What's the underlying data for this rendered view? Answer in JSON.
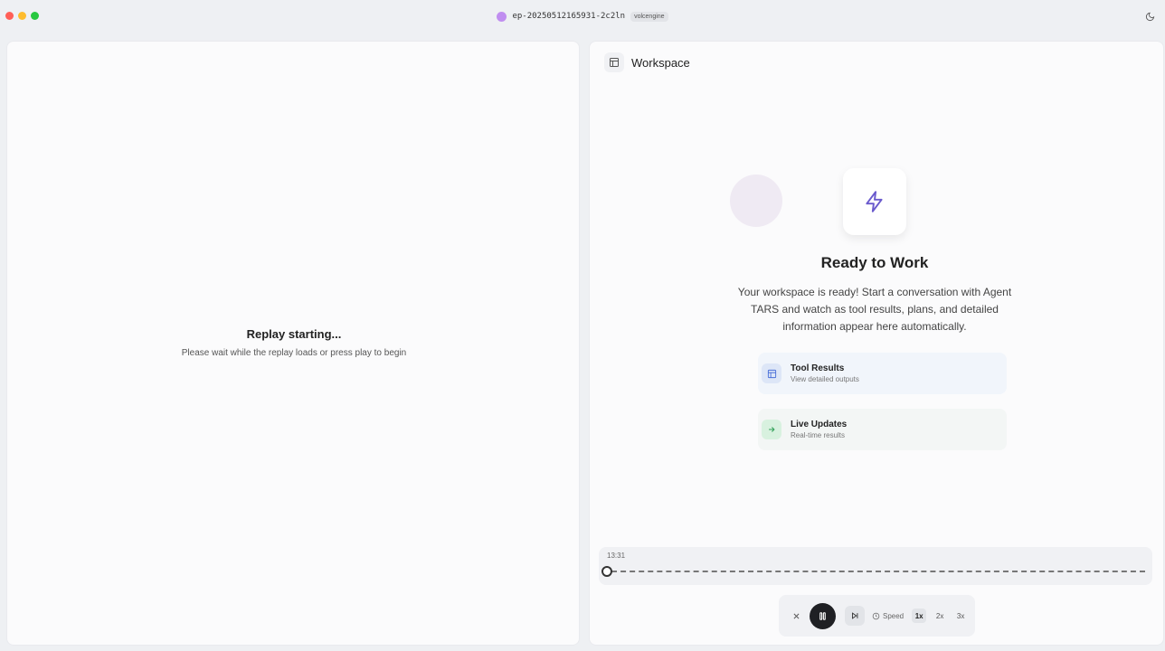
{
  "titlebar": {
    "session_id": "ep-20250512165931-2c2ln",
    "model_badge": "volcengine"
  },
  "left": {
    "replay_title": "Replay starting...",
    "replay_sub": "Please wait while the replay loads or press play to begin"
  },
  "workspace": {
    "title": "Workspace",
    "ready_title": "Ready to Work",
    "ready_desc": "Your workspace is ready! Start a conversation with Agent TARS and watch as tool results, plans, and detailed information appear here automatically.",
    "features": [
      {
        "title": "Tool Results",
        "subtitle": "View detailed outputs",
        "icon": "panel-icon"
      },
      {
        "title": "Live Updates",
        "subtitle": "Real-time results",
        "icon": "arrow-right-icon"
      }
    ]
  },
  "player": {
    "time": "13:31",
    "progress": 0,
    "speed_label": "Speed",
    "speeds": [
      "1x",
      "2x",
      "3x"
    ],
    "active_speed": "1x"
  },
  "colors": {
    "accent_purple": "#c08ef0",
    "bolt": "#6a5acd"
  }
}
